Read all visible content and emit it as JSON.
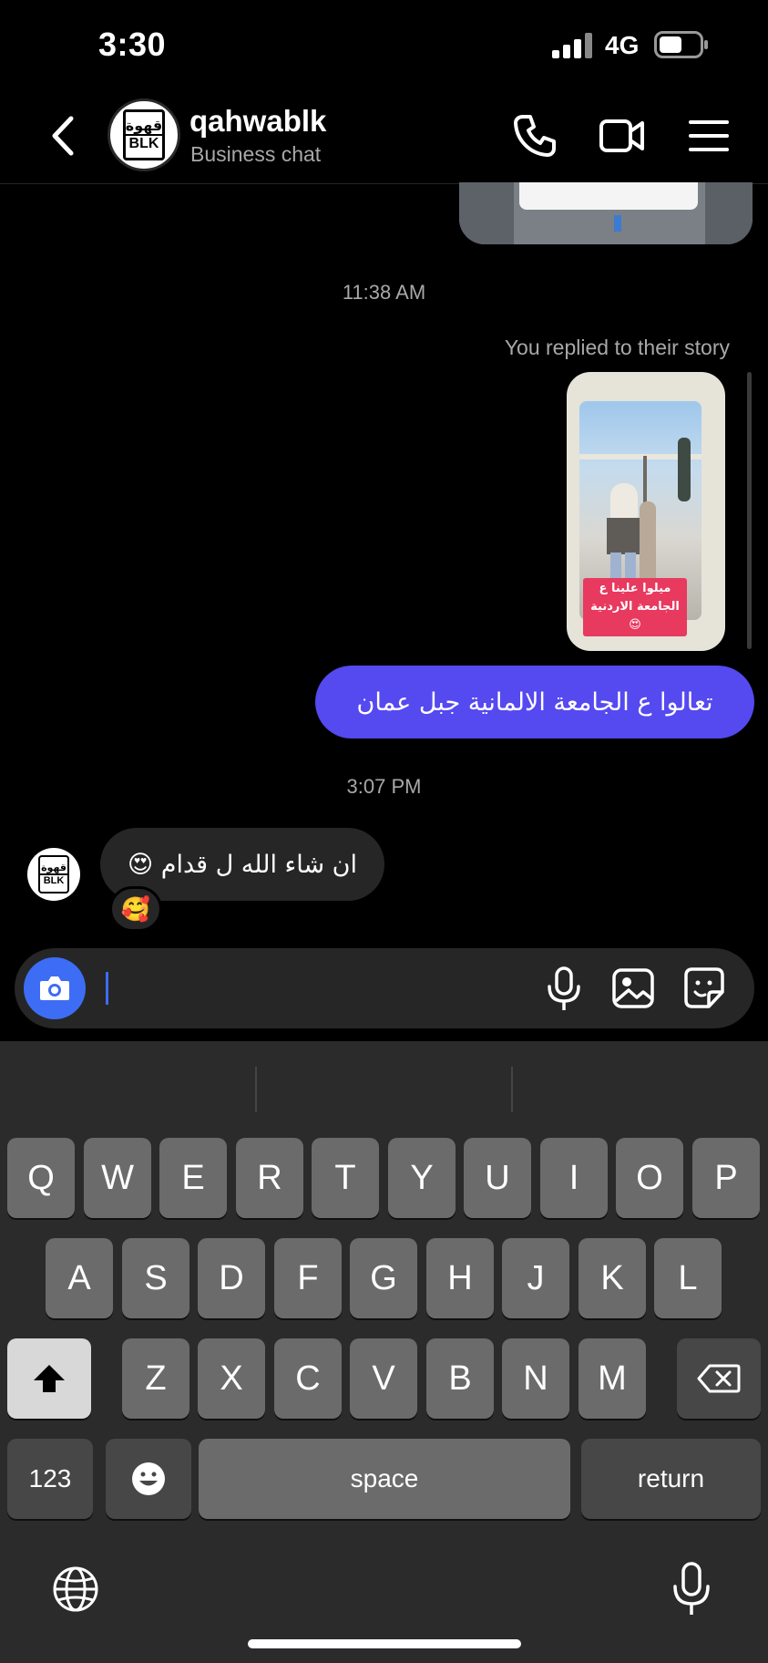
{
  "status_bar": {
    "time": "3:30",
    "network": "4G"
  },
  "header": {
    "name": "qahwablk",
    "subtitle": "Business chat",
    "logo_text_ar": "قهوة",
    "logo_text_en": "BLK"
  },
  "messages": {
    "timestamp_1": "11:38 AM",
    "replied_label": "You replied to their story",
    "story_caption": "ميلوا علينا ع الجامعة الاردنية 😍",
    "outgoing_text": "تعالوا ع الجامعة الالمانية جبل عمان",
    "timestamp_2": "3:07 PM",
    "incoming_text": "ان شاء الله ل قدام 😍",
    "reaction": "🥰"
  },
  "keyboard": {
    "row1": [
      "Q",
      "W",
      "E",
      "R",
      "T",
      "Y",
      "U",
      "I",
      "O",
      "P"
    ],
    "row2": [
      "A",
      "S",
      "D",
      "F",
      "G",
      "H",
      "J",
      "K",
      "L"
    ],
    "row3": [
      "Z",
      "X",
      "C",
      "V",
      "B",
      "N",
      "M"
    ],
    "numbers_label": "123",
    "space_label": "space",
    "return_label": "return"
  },
  "colors": {
    "accent": "#3d6df5",
    "outgoing_bubble": "#5549f0",
    "incoming_bubble": "#262626"
  }
}
